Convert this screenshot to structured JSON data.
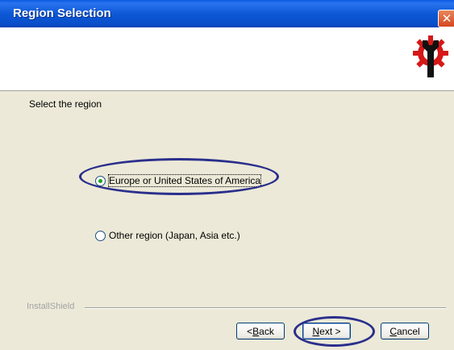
{
  "window": {
    "title": "Region Selection",
    "close_glyph": "✕"
  },
  "header": {
    "logo_icon": "installshield-gear-wrench-icon"
  },
  "content": {
    "prompt": "Select the region",
    "options": [
      {
        "label": "Europe or United States of America",
        "checked": true
      },
      {
        "label": "Other region (Japan, Asia etc.)",
        "checked": false
      }
    ]
  },
  "footer": {
    "brand": "InstallShield",
    "buttons": {
      "back": {
        "pre": "< ",
        "key": "B",
        "rest": "ack"
      },
      "next": {
        "key": "N",
        "rest": "ext >"
      },
      "cancel": {
        "key": "C",
        "rest": "ancel"
      }
    }
  },
  "colors": {
    "highlight": "#2a2f8c",
    "titlebar": "#0a55d8",
    "background": "#ece9d8"
  }
}
